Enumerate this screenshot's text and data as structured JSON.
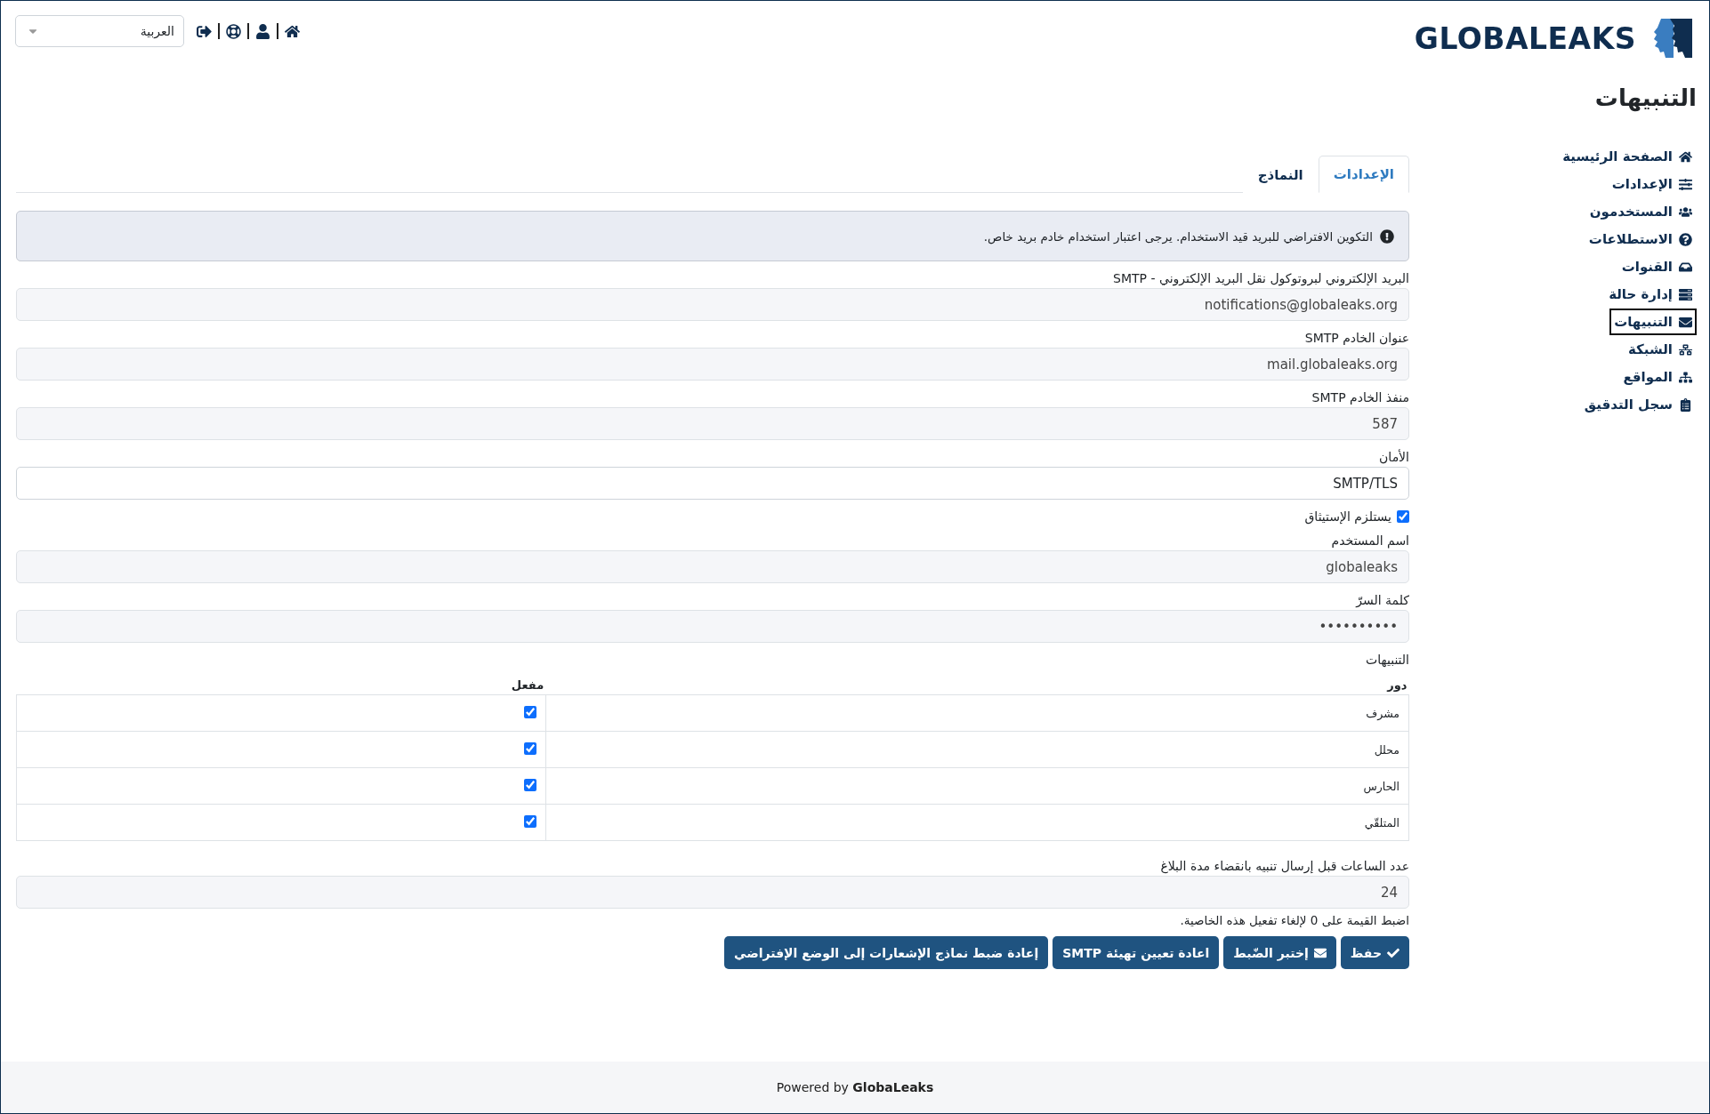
{
  "header": {
    "logo_text": "GLOBALEAKS",
    "language_select": {
      "value": "العربية"
    }
  },
  "sidebar": {
    "title": "التنبيهات",
    "items": [
      {
        "label": "الصفحة الرئيسية",
        "selected": false
      },
      {
        "label": "الإعدادات",
        "selected": false
      },
      {
        "label": "المستخدمون",
        "selected": false
      },
      {
        "label": "الاستطلاعات",
        "selected": false
      },
      {
        "label": "القنوات",
        "selected": false
      },
      {
        "label": "إدارة حالة",
        "selected": false
      },
      {
        "label": "التنبيهات",
        "selected": true
      },
      {
        "label": "الشبكة",
        "selected": false
      },
      {
        "label": "المواقع",
        "selected": false
      },
      {
        "label": "سجل التدقيق",
        "selected": false
      }
    ]
  },
  "tabs": [
    {
      "label": "الإعدادات",
      "selected": true
    },
    {
      "label": "النماذج",
      "selected": false
    }
  ],
  "alert": {
    "text": "التكوين الافتراضي للبريد قيد الاستخدام. يرجى اعتبار استخدام خادم بريد خاص."
  },
  "fields": [
    {
      "kind": "text",
      "label": "البريد الإلكتروني لبروتوكول نقل البريد الإلكتروني - SMTP",
      "value": "notifications@globaleaks.org"
    },
    {
      "kind": "text",
      "label": "عنوان الخادم SMTP",
      "value": "mail.globaleaks.org"
    },
    {
      "kind": "text",
      "label": "منفذ الخادم SMTP",
      "value": "587"
    },
    {
      "kind": "select",
      "label": "الأمان",
      "value": "SMTP/TLS"
    },
    {
      "kind": "checkbox",
      "label": "يستلزم الإستيثاق",
      "checked": true
    },
    {
      "kind": "text",
      "label": "اسم المستخدم",
      "value": "globaleaks"
    },
    {
      "kind": "text",
      "label": "كلمة السرّ",
      "value": "••••••••••"
    }
  ],
  "notifications": {
    "label": "التنبيهات",
    "columns": [
      "دور",
      "مفعل"
    ],
    "rows": [
      {
        "role": "مشرف",
        "enabled": true
      },
      {
        "role": "محلل",
        "enabled": true
      },
      {
        "role": "الحارس",
        "enabled": true
      },
      {
        "role": "المتلقّي",
        "enabled": true
      }
    ]
  },
  "expiration": {
    "label": "عدد الساعات قبل إرسال تنبيه بانقضاء مدة البلاغ",
    "value": "24",
    "hint": "اضبط القيمة على 0 لإلغاء تفعيل هذه الخاصية."
  },
  "buttons": [
    {
      "label": "حفظ"
    },
    {
      "label": "إختبر الضّبط"
    },
    {
      "label": "اعادة تعيين تهيئة SMTP"
    },
    {
      "label": "إعادة ضبط نماذج الإشعارات إلى الوضع الإفتراضي"
    }
  ],
  "footer": {
    "text": "Powered by **GlobaLeaks**"
  }
}
